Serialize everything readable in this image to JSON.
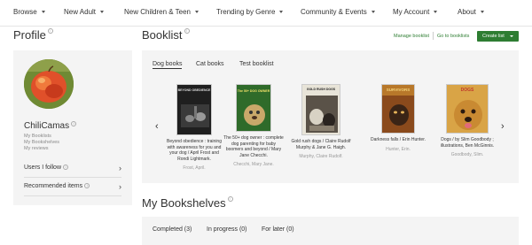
{
  "nav": {
    "items": [
      {
        "label": "Browse"
      },
      {
        "label": "New Adult"
      },
      {
        "label": "New Children & Teen"
      },
      {
        "label": "Trending by Genre"
      },
      {
        "label": "Community & Events"
      },
      {
        "label": "My Account"
      },
      {
        "label": "About"
      }
    ]
  },
  "profile": {
    "title": "Profile",
    "username": "ChiliCamas",
    "links": [
      "My Booklists",
      "My Bookshelves",
      "My reviews"
    ],
    "users_follow": "Users I follow",
    "recommended": "Recommended items"
  },
  "booklist": {
    "title": "Booklist",
    "manage": "Manage booklist",
    "goto": "Go to booklists",
    "create": "Create list",
    "tabs": [
      {
        "label": "Dog books"
      },
      {
        "label": "Cat books"
      },
      {
        "label": "Test booklist"
      }
    ],
    "books": [
      {
        "title": "Beyond obedience : training with awareness for you and your dog / April Frost and Rondi Lightmark.",
        "author": "Frost, April.",
        "cover_text": "BEYOND OBEDIENCE"
      },
      {
        "title": "The 50+ dog owner : complete dog parenting for baby boomers and beyond / Mary Jane Checchi.",
        "author": "Checchi, Mary Jane.",
        "cover_text": "The 50+ DOG OWNER"
      },
      {
        "title": "Gold rush dogs / Claire Rudolf Murphy & Jane G. Haigh.",
        "author": "Murphy, Claire Rudolf.",
        "cover_text": "GOLD RUSH DOGS"
      },
      {
        "title": "Darkness falls / Erin Hunter.",
        "author": "Hunter, Erin.",
        "cover_text": "SURVIVORS"
      },
      {
        "title": "Dogs / by Slim Goodbody ; illustrations, Ben McGinnis.",
        "author": "Goodbody, Slim.",
        "cover_text": "DOGS"
      }
    ]
  },
  "shelves": {
    "title": "My Bookshelves",
    "tabs": [
      {
        "label": "Completed (3)"
      },
      {
        "label": "In progress (0)"
      },
      {
        "label": "For later (0)"
      }
    ]
  }
}
